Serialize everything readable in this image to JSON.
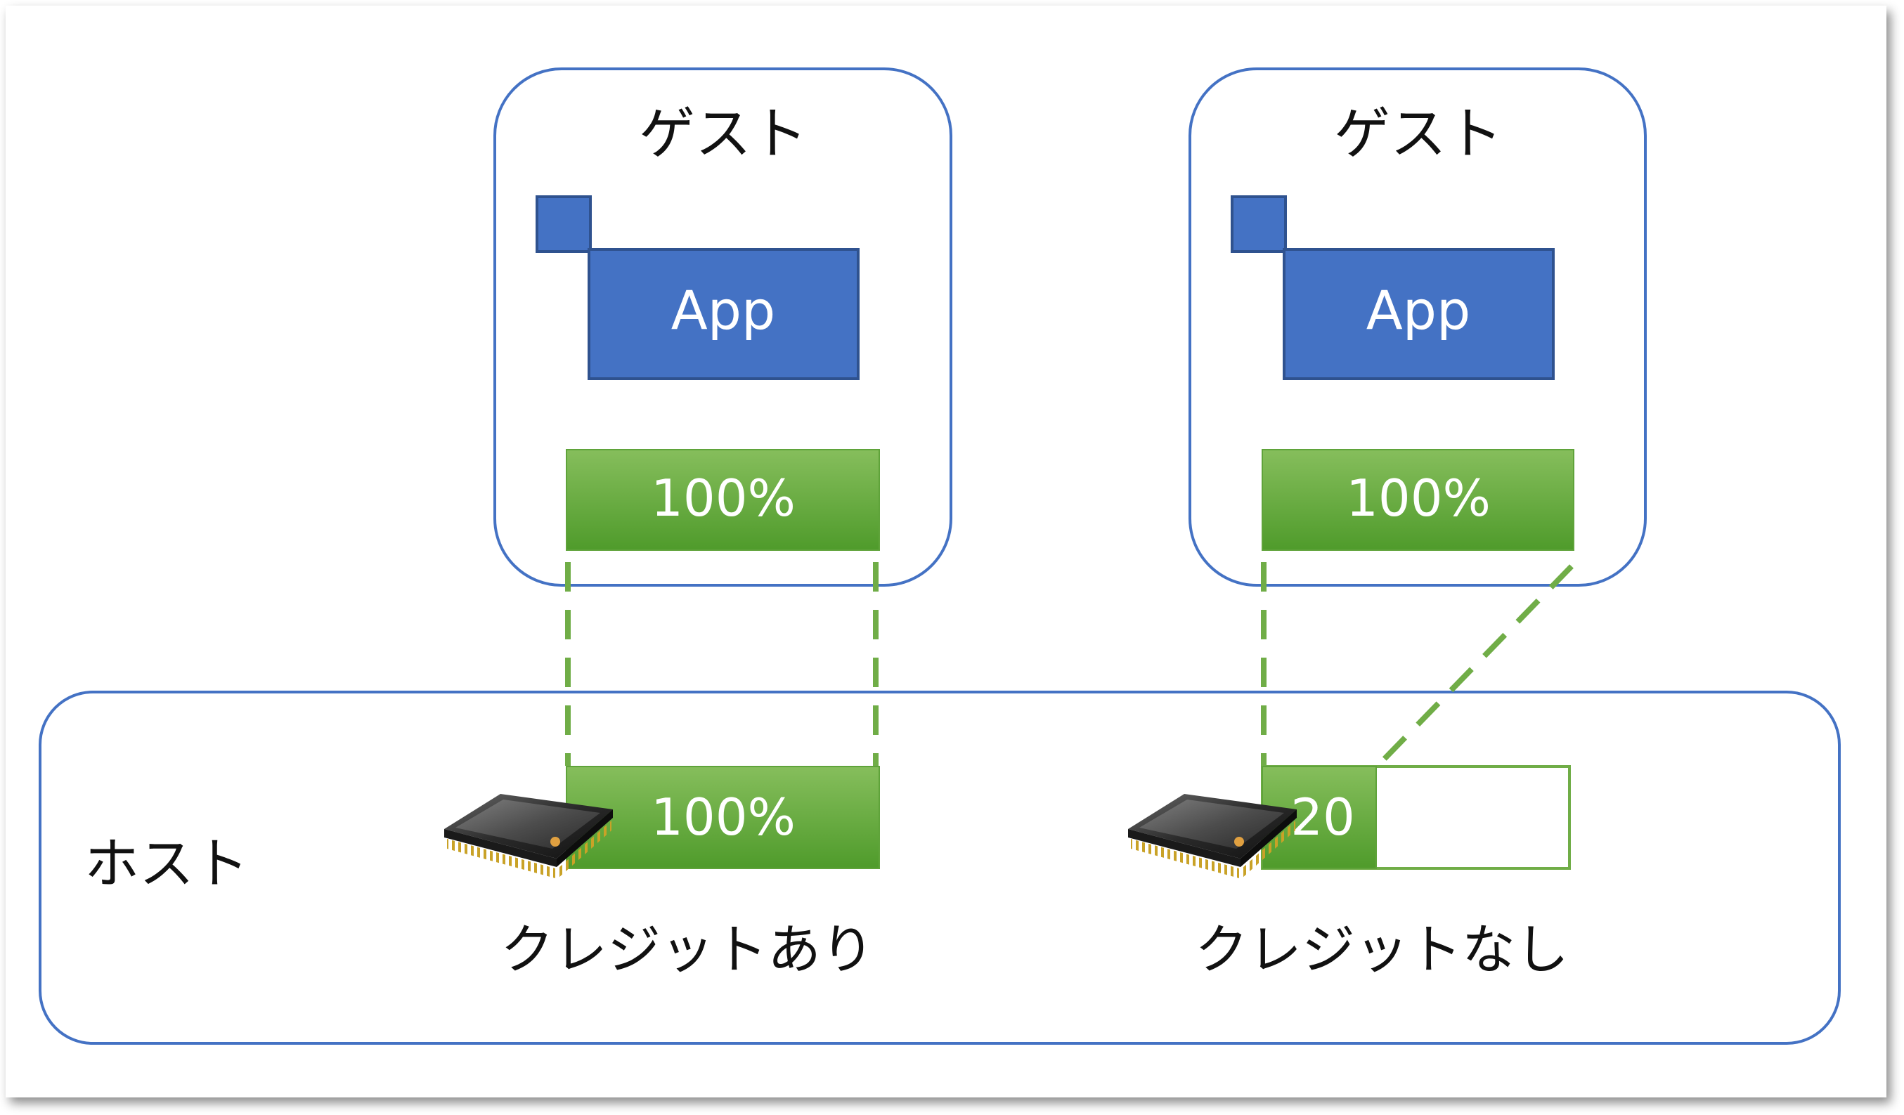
{
  "guests": [
    {
      "title": "ゲスト",
      "app_label": "App",
      "usage_label": "100%"
    },
    {
      "title": "ゲスト",
      "app_label": "App",
      "usage_label": "100%"
    }
  ],
  "host": {
    "title": "ホスト",
    "cpu_left": {
      "usage_label": "100%",
      "caption": "クレジットあり",
      "fill_fraction": 1.0
    },
    "cpu_right": {
      "usage_label": "20",
      "caption": "クレジットなし",
      "fill_fraction": 0.2
    }
  },
  "icons": {
    "cpu": "cpu-chip-icon",
    "window": "app-window-icon"
  },
  "colors": {
    "frame_stroke": "#4472C4",
    "app_fill": "#4472C4",
    "app_stroke": "#2F528F",
    "bar_fill_top": "#84BD5A",
    "bar_fill_bottom": "#4E9A2A",
    "dash": "#70AD47",
    "card_bg": "#FFFFFF"
  }
}
